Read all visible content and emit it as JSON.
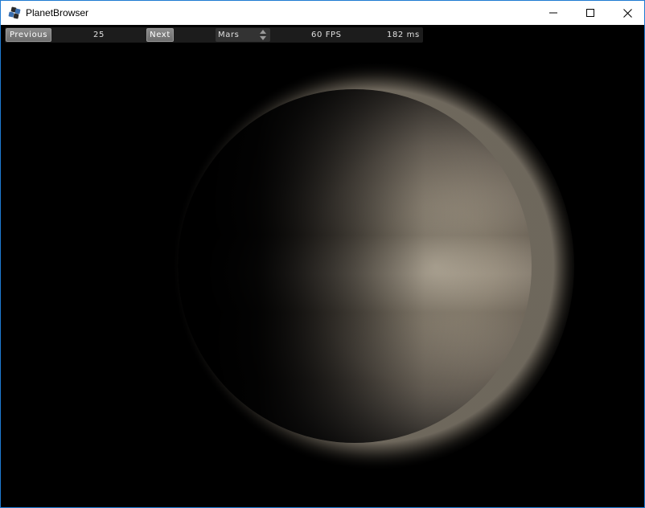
{
  "window": {
    "title": "PlanetBrowser",
    "icons": {
      "app": "app-icon",
      "minimize": "minimize-icon",
      "maximize": "maximize-icon",
      "close": "close-icon"
    }
  },
  "toolbar": {
    "previous_label": "Previous",
    "frame_number": "25",
    "next_label": "Next",
    "planet_select": {
      "selected": "Mars",
      "icon": "up-down-arrows-icon"
    },
    "fps": "60 FPS",
    "frame_time": "182 ms"
  },
  "scene": {
    "planet_color": "#8a8070",
    "background": "#000000"
  },
  "colors": {
    "window_border": "#1f7ad2",
    "toolbar_bg": "#1c1c1c",
    "button_bg": "#7c7c7c"
  }
}
